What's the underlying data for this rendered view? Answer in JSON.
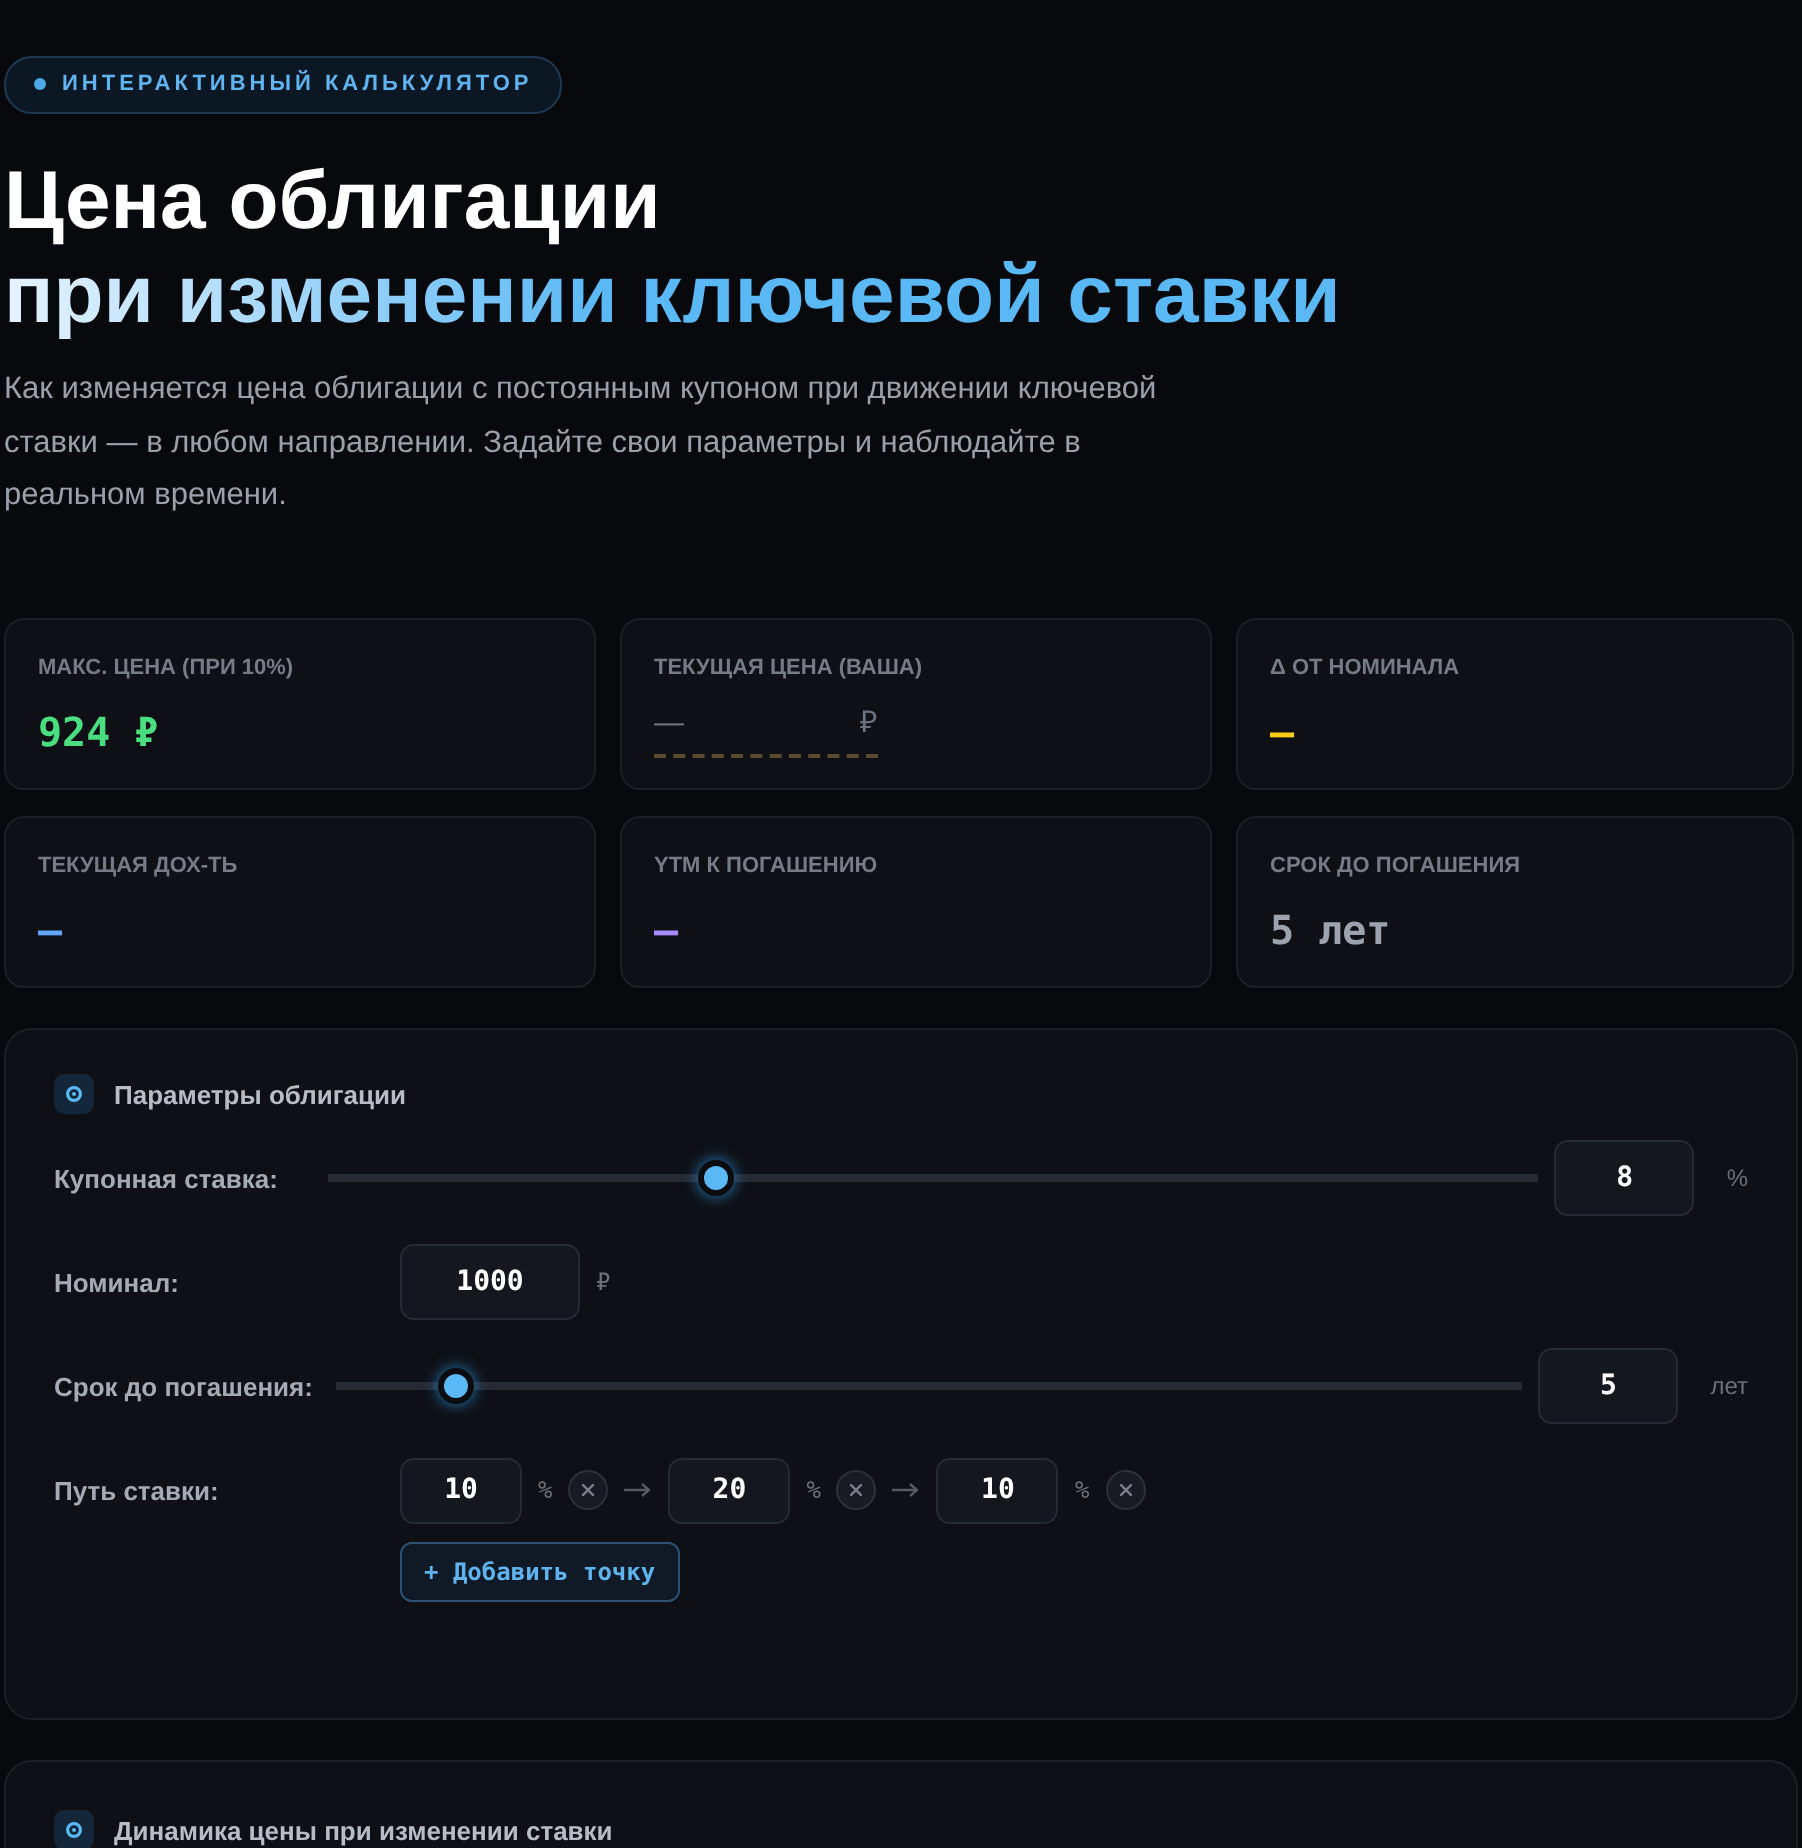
{
  "badge": "ИНТЕРАКТИВНЫЙ КАЛЬКУЛЯТОР",
  "title": {
    "line_1": "Цена облигации",
    "line_2": "при изменении ключевой ставки"
  },
  "description": "Как изменяется цена облигации с постоянным купоном при движении ключевой ставки — в любом направлении. Задайте свои параметры и наблюдайте в реальном времени.",
  "stats": [
    {
      "label": "МАКС. ЦЕНА (ПРИ 10%)",
      "kind": "value",
      "value": "924 ₽",
      "color": "#4ade80"
    },
    {
      "label": "ТЕКУЩАЯ ЦЕНА (ВАША)",
      "kind": "input",
      "placeholder": "—",
      "unit": "₽",
      "color": "#6b7280"
    },
    {
      "label": "Δ ОТ НОМИНАЛА",
      "kind": "value",
      "value": "—",
      "color": "#facc15"
    },
    {
      "label": "ТЕКУЩАЯ ДОХ-ТЬ",
      "kind": "value",
      "value": "—",
      "color": "#60a5fa"
    },
    {
      "label": "YTM К ПОГАШЕНИЮ",
      "kind": "value",
      "value": "—",
      "color": "#a78bfa"
    },
    {
      "label": "СРОК ДО ПОГАШЕНИЯ",
      "kind": "value",
      "value": "5 лет",
      "color": "#9ca3af"
    }
  ],
  "parameters": {
    "title": "Параметры облигации",
    "rows": [
      {
        "kind": "slider",
        "label": "Купонная ставка:",
        "level": 0.32,
        "value": "8",
        "unit": "%"
      },
      {
        "kind": "input",
        "label": "Номинал:",
        "value": "1000",
        "unit": "₽"
      },
      {
        "kind": "slider",
        "label": "Срок до погашения:",
        "level": 0.1,
        "value": "5",
        "unit": "лет"
      }
    ],
    "rate_path": {
      "label": "Путь ставки:",
      "points": [
        {
          "value": "10",
          "unit": "%"
        },
        {
          "value": "20",
          "unit": "%"
        },
        {
          "value": "10",
          "unit": "%"
        }
      ],
      "add_button": "+ Добавить точку"
    }
  },
  "chart_panel": {
    "title": "Динамика цены при изменении ставки"
  }
}
